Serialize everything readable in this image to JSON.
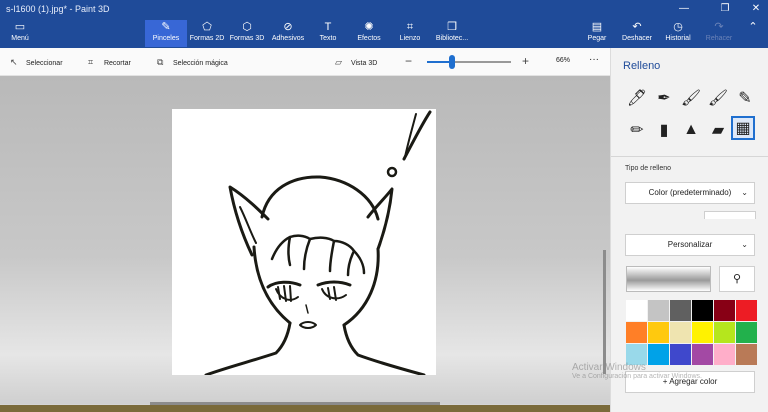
{
  "window": {
    "title": "s-l1600 (1).jpg* - Paint 3D",
    "controls": [
      "minimize-icon",
      "restore-icon",
      "close-icon"
    ]
  },
  "ribbon": {
    "menu_label": "Menú",
    "tabs": [
      {
        "label": "Pinceles",
        "icon": "brush-icon",
        "active": true
      },
      {
        "label": "Formas 2D",
        "icon": "shapes-2d-icon"
      },
      {
        "label": "Formas 3D",
        "icon": "shapes-3d-icon"
      },
      {
        "label": "Adhesivos",
        "icon": "stickers-icon"
      },
      {
        "label": "Texto",
        "icon": "text-icon"
      },
      {
        "label": "Efectos",
        "icon": "effects-icon"
      },
      {
        "label": "Lienzo",
        "icon": "canvas-icon"
      },
      {
        "label": "Bibliotec...",
        "icon": "library-icon"
      }
    ],
    "right_actions": [
      {
        "label": "Pegar",
        "icon": "paste-icon"
      },
      {
        "label": "Deshacer",
        "icon": "undo-icon"
      },
      {
        "label": "Historial",
        "icon": "history-icon"
      },
      {
        "label": "Rehacer",
        "icon": "redo-icon",
        "disabled": true
      }
    ],
    "colors": {
      "ribbon": "#1f4b99",
      "active_tab": "#3867d6"
    }
  },
  "toolbar": {
    "select_label": "Seleccionar",
    "crop_label": "Recortar",
    "magic_select_label": "Selección mágica",
    "view3d_label": "Vista 3D",
    "zoom_value": "66%",
    "zoom_fraction": 0.3,
    "more_icon": "more-icon"
  },
  "panel": {
    "title": "Relleno",
    "brushes": [
      "marker-icon",
      "calligraphy-pen-icon",
      "oil-brush-icon",
      "watercolor-icon",
      "pixel-pencil-icon",
      "pencil-icon",
      "eraser-icon",
      "crayon-icon",
      "spray-can-icon",
      "fill-icon"
    ],
    "selected_brush": 9,
    "fill_type_label": "Tipo de relleno",
    "fill_type_value": "Color (predeterminado)",
    "customize_label": "Personalizar",
    "add_color_label": "Agregar color",
    "palette": [
      "#ffffff",
      "#c4c4c4",
      "#606060",
      "#000000",
      "#880015",
      "#ed1c24",
      "#ff7f27",
      "#ffc90e",
      "#efe4b0",
      "#fff200",
      "#b5e61d",
      "#22b14c",
      "#99d9ea",
      "#00a2e8",
      "#3f48cc",
      "#a349a4",
      "#ffaec9",
      "#b97a57"
    ]
  },
  "watermark": {
    "title": "Activar Windows",
    "subtitle": "Ve a Configuración para activar Windows."
  }
}
